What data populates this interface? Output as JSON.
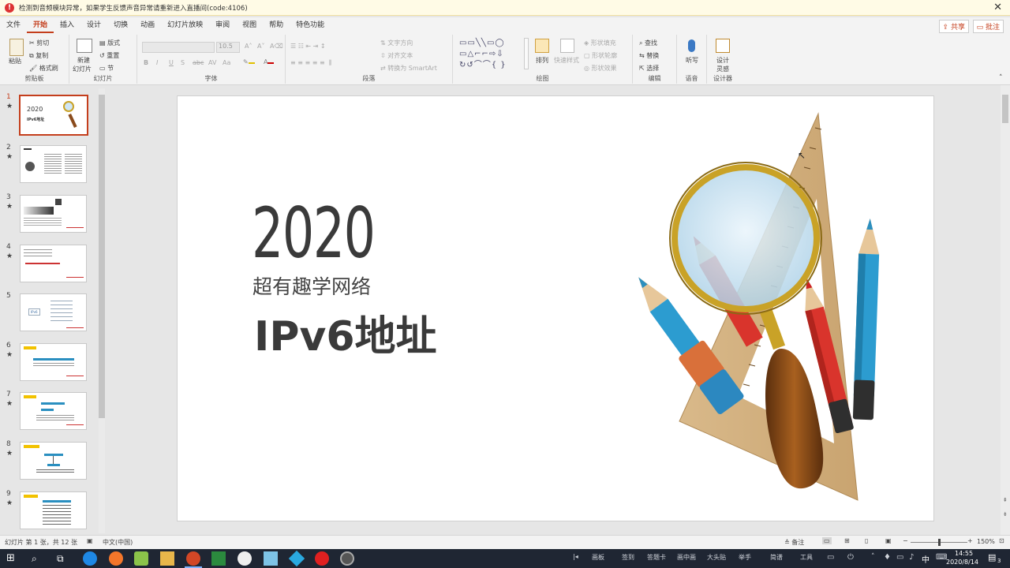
{
  "alert": {
    "message": "检测到音频模块异常，如果学生反馈声音异常请重新进入直播间(code:4106)",
    "close": "✕"
  },
  "menu_tabs": [
    "文件",
    "开始",
    "插入",
    "设计",
    "切换",
    "动画",
    "幻灯片放映",
    "审阅",
    "视图",
    "帮助",
    "特色功能"
  ],
  "active_tab": "开始",
  "share_label": "共享",
  "comment_label": "批注",
  "ribbon": {
    "clipboard": {
      "paste": "粘贴",
      "cut": "剪切",
      "copy": "复制",
      "format_painter": "格式刷",
      "label": "剪贴板"
    },
    "slides": {
      "new_slide_line1": "新建",
      "new_slide_line2": "幻灯片",
      "layout": "版式",
      "reset": "重置",
      "section": "节",
      "label": "幻灯片"
    },
    "font": {
      "font_size": "10.5",
      "bold": "B",
      "italic": "I",
      "underline": "U",
      "strike": "S",
      "shadow": "abc",
      "spacing": "AV",
      "case": "Aa",
      "label": "字体"
    },
    "paragraph": {
      "text_direction": "文字方向",
      "align_text": "对齐文本",
      "smartart": "转换为 SmartArt",
      "label": "段落"
    },
    "drawing": {
      "arrange": "排列",
      "quick_styles": "快速样式",
      "shape_fill": "形状填充",
      "shape_outline": "形状轮廓",
      "shape_effects": "形状效果",
      "label": "绘图"
    },
    "editing": {
      "find": "查找",
      "replace": "替换",
      "select": "选择",
      "label": "编辑"
    },
    "voice": {
      "dictate": "听写",
      "label": "语音"
    },
    "designer": {
      "design_line1": "设计",
      "design_line2": "灵感",
      "label": "设计器"
    }
  },
  "thumbnails": [
    {
      "number": "1",
      "title_year": "2020",
      "title": "IPv6地址"
    },
    {
      "number": "2"
    },
    {
      "number": "3"
    },
    {
      "number": "4"
    },
    {
      "number": "5",
      "caption": "IPv6"
    },
    {
      "number": "6"
    },
    {
      "number": "7"
    },
    {
      "number": "8"
    },
    {
      "number": "9"
    }
  ],
  "star": "★",
  "slide": {
    "year": "2020",
    "subtitle": "超有趣学网络",
    "title": "IPv6地址"
  },
  "status": {
    "slide_info": "幻灯片 第 1 张，共 12 张",
    "language": "中文(中国)",
    "notes": "备注",
    "zoom": "150%"
  },
  "taskbar": {
    "tray_items": [
      "画板",
      "签到",
      "答题卡",
      "画中画",
      "大头贴",
      "举手",
      "简谱",
      "工具"
    ],
    "ime": "中",
    "time": "14:55",
    "date": "2020/8/14",
    "notification_count": "3"
  },
  "colors": {
    "accent": "#c43e1c",
    "taskbar": "#1f2633",
    "title_text": "#3a3a3a"
  }
}
